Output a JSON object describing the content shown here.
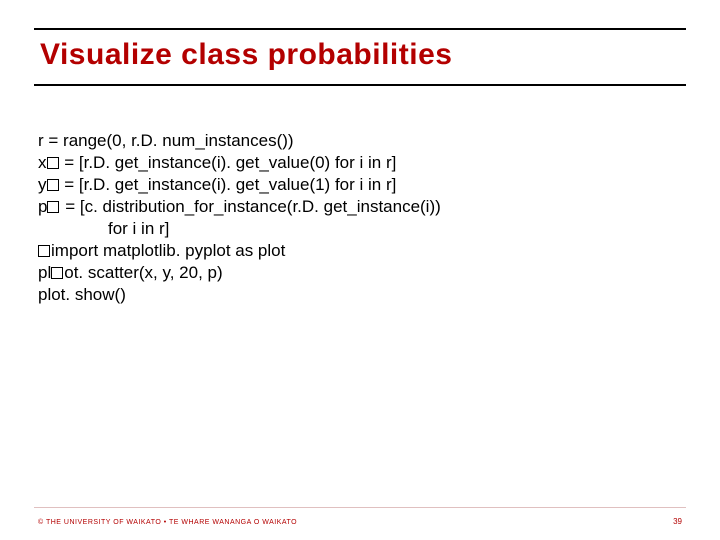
{
  "title": "Visualize class probabilities",
  "code": {
    "l1": "r = range(0, r.D. num_instances())",
    "l2a": "x",
    "l2b": " = [r.D. get_instance(i). get_value(0) for i in r]",
    "l3a": "y",
    "l3b": " = [r.D. get_instance(i). get_value(1) for i in r]",
    "l4a": "p",
    "l4b": " = [c. distribution_for_instance(r.D. get_instance(i))",
    "l5": "for i in r]",
    "l6a": "im",
    "l6b": "port matplotlib. pyplot as plot",
    "l7a": "pl",
    "l7b": "ot. scatter(x, y, 20, p)",
    "l8": "plot. show()"
  },
  "footer": {
    "left": "© THE UNIVERSITY OF WAIKATO  •  TE WHARE WANANGA O WAIKATO",
    "page": "39"
  }
}
